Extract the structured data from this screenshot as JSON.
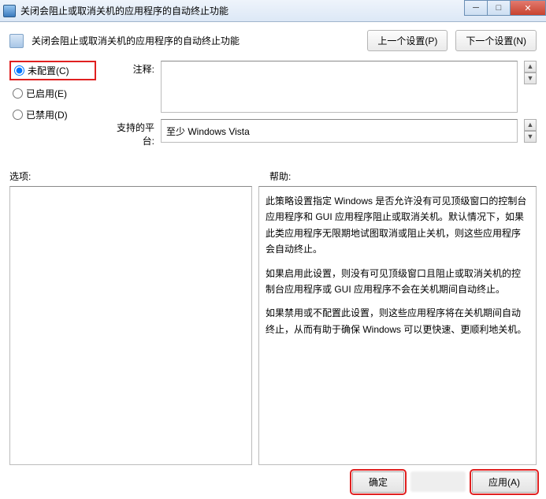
{
  "window": {
    "title": "关闭会阻止或取消关机的应用程序的自动终止功能",
    "min_icon": "─",
    "max_icon": "□",
    "close_icon": "✕"
  },
  "header": {
    "title": "关闭会阻止或取消关机的应用程序的自动终止功能",
    "prev_btn": "上一个设置(P)",
    "next_btn": "下一个设置(N)"
  },
  "radios": {
    "not_configured": "未配置(C)",
    "enabled": "已启用(E)",
    "disabled": "已禁用(D)"
  },
  "fields": {
    "comment_label": "注释:",
    "comment_value": "",
    "platform_label": "支持的平台:",
    "platform_value": "至少 Windows Vista"
  },
  "section_labels": {
    "options": "选项:",
    "help": "帮助:"
  },
  "help": {
    "p1": "此策略设置指定 Windows 是否允许没有可见顶级窗口的控制台应用程序和 GUI 应用程序阻止或取消关机。默认情况下，如果此类应用程序无限期地试图取消或阻止关机，则这些应用程序会自动终止。",
    "p2": "如果启用此设置，则没有可见顶级窗口且阻止或取消关机的控制台应用程序或 GUI 应用程序不会在关机期间自动终止。",
    "p3": "如果禁用或不配置此设置，则这些应用程序将在关机期间自动终止，从而有助于确保 Windows 可以更快速、更顺利地关机。"
  },
  "footer": {
    "ok": "确定",
    "apply": "应用(A)"
  }
}
